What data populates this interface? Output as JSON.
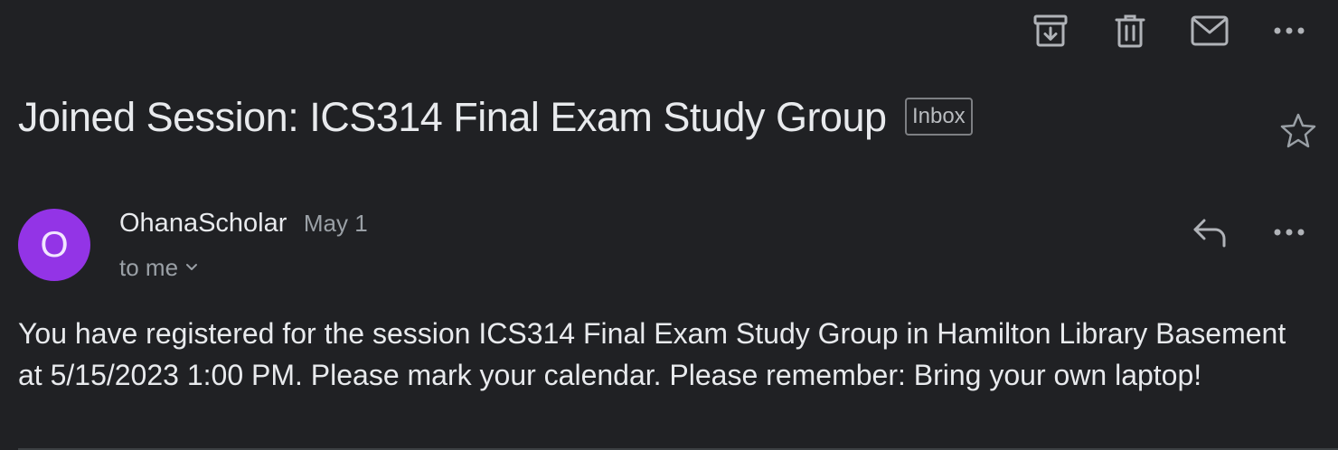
{
  "toolbar": {
    "icons": [
      "archive-icon",
      "delete-icon",
      "mark-unread-icon",
      "more-icon"
    ]
  },
  "email": {
    "subject": "Joined Session: ICS314 Final Exam Study Group",
    "label": "Inbox",
    "sender": {
      "avatar_letter": "O",
      "name": "OhanaScholar",
      "date": "May 1",
      "recipient": "to me",
      "avatar_color": "#9334e6"
    },
    "body": "You have registered for the session ICS314 Final Exam Study Group in Hamilton Library Basement at 5/15/2023 1:00 PM. Please mark your calendar. Please remember: Bring your own laptop!"
  },
  "colors": {
    "background": "#202124",
    "text": "#e8eaed",
    "muted": "#9aa0a6"
  }
}
